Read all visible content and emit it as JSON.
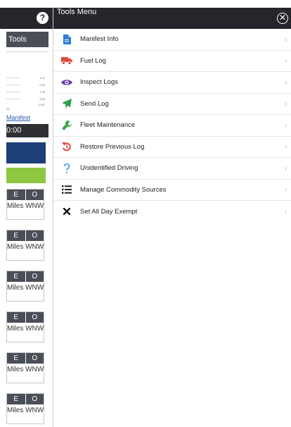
{
  "background_app": {
    "tools_button_label": "Tools",
    "help_glyph": "?",
    "mini_values": [
      "3.37",
      "0.00",
      "7.50",
      "1.00",
      "11.87"
    ],
    "mini_left_value": "23",
    "manifest_link": "Manifest",
    "time_value": "0:00",
    "cards": [
      {
        "e": "E",
        "o": "O",
        "dist": "Miles WNW"
      },
      {
        "e": "E",
        "o": "O",
        "dist": "Miles WNW"
      },
      {
        "e": "E",
        "o": "O",
        "dist": "Miles WNW"
      },
      {
        "e": "E",
        "o": "O",
        "dist": "Miles WNW"
      },
      {
        "e": "E",
        "o": "O",
        "dist": "Miles WNW"
      },
      {
        "e": "E",
        "o": "O",
        "dist": "Miles WNW"
      }
    ],
    "colors": {
      "blue_block": "#1c3f78",
      "green_block": "#8dc63f"
    }
  },
  "panel": {
    "title": "Tools Menu",
    "close_glyph": "✕",
    "items": [
      {
        "label": "Manifest Info",
        "icon": "document-icon",
        "color": "#2b7fd6"
      },
      {
        "label": "Fuel Log",
        "icon": "truck-icon",
        "color": "#e04a3c"
      },
      {
        "label": "Inspect Logs",
        "icon": "eye-icon",
        "color": "#6a3fa8"
      },
      {
        "label": "Send Log",
        "icon": "paper-plane-icon",
        "color": "#2e9f4a"
      },
      {
        "label": "Fleet Maintenance",
        "icon": "wrench-icon",
        "color": "#3aa648"
      },
      {
        "label": "Restore Previous Log",
        "icon": "restore-icon",
        "color": "#e04a3c"
      },
      {
        "label": "Unidentified Driving",
        "icon": "question-icon",
        "color": "#5b9bd5"
      },
      {
        "label": "Manage Commodity Sources",
        "icon": "list-icon",
        "color": "#222222"
      },
      {
        "label": "Set All Day Exempt",
        "icon": "x-icon",
        "color": "#111111"
      }
    ],
    "chevron_glyph": "›"
  }
}
